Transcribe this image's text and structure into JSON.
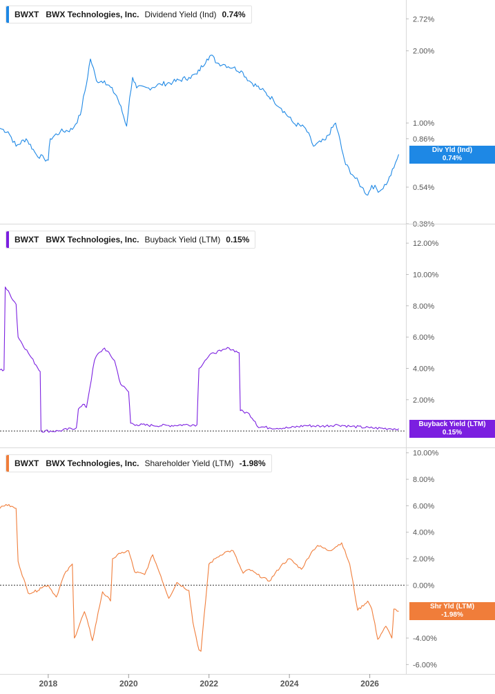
{
  "colors": {
    "dividend": "#1e88e5",
    "buyback": "#7b1fe0",
    "shareholder": "#f07d3a",
    "divider": "#d9d9d9",
    "axis_text": "#555555"
  },
  "x_axis": {
    "range": [
      2016.8,
      2026.9
    ],
    "ticks": [
      {
        "value": 2018,
        "label": "2018"
      },
      {
        "value": 2020,
        "label": "2020"
      },
      {
        "value": 2022,
        "label": "2022"
      },
      {
        "value": 2024,
        "label": "2024"
      },
      {
        "value": 2026,
        "label": "2026"
      }
    ]
  },
  "panels": [
    {
      "id": "dividend",
      "legend": {
        "ticker": "BWXT",
        "company": "BWX Technologies, Inc.",
        "metric": "Dividend Yield (Ind)",
        "value": "0.74%"
      },
      "badge": {
        "label": "Div Yld (Ind)",
        "value": "0.74%"
      },
      "badge_hidden_tick": "0.70%",
      "scale": "log",
      "ylim": [
        0.38,
        3.05
      ],
      "ticks": [
        {
          "value": 2.72,
          "label": "2.72%"
        },
        {
          "value": 2.0,
          "label": "2.00%"
        },
        {
          "value": 1.0,
          "label": "1.00%"
        },
        {
          "value": 0.86,
          "label": "0.86%"
        },
        {
          "value": 0.54,
          "label": "0.54%"
        },
        {
          "value": 0.38,
          "label": "0.38%"
        }
      ],
      "zero_line": false
    },
    {
      "id": "buyback",
      "legend": {
        "ticker": "BWXT",
        "company": "BWX Technologies, Inc.",
        "metric": "Buyback Yield (LTM)",
        "value": "0.15%"
      },
      "badge": {
        "label": "Buyback Yield (LTM)",
        "value": "0.15%"
      },
      "scale": "linear",
      "ylim": [
        -0.7,
        12.8
      ],
      "ticks": [
        {
          "value": 12,
          "label": "12.00%"
        },
        {
          "value": 10,
          "label": "10.00%"
        },
        {
          "value": 8,
          "label": "8.00%"
        },
        {
          "value": 6,
          "label": "6.00%"
        },
        {
          "value": 4,
          "label": "4.00%"
        },
        {
          "value": 2,
          "label": "2.00%"
        }
      ],
      "zero_line": true
    },
    {
      "id": "shareholder",
      "legend": {
        "ticker": "BWXT",
        "company": "BWX Technologies, Inc.",
        "metric": "Shareholder Yield (LTM)",
        "value": "-1.98%"
      },
      "badge": {
        "label": "Shr Yld (LTM)",
        "value": "-1.98%"
      },
      "scale": "linear",
      "ylim": [
        -6.4,
        10.3
      ],
      "ticks": [
        {
          "value": 10,
          "label": "10.00%"
        },
        {
          "value": 8,
          "label": "8.00%"
        },
        {
          "value": 6,
          "label": "6.00%"
        },
        {
          "value": 4,
          "label": "4.00%"
        },
        {
          "value": 2,
          "label": "2.00%"
        },
        {
          "value": 0,
          "label": "0.00%"
        },
        {
          "value": -4,
          "label": "-4.00%"
        },
        {
          "value": -6,
          "label": "-6.00%"
        }
      ],
      "zero_line": true
    }
  ],
  "chart_data": [
    {
      "type": "line",
      "series": [
        {
          "name": "Dividend Yield (Ind)"
        }
      ],
      "scale": "log",
      "x": [
        2016.8,
        2017.0,
        2017.2,
        2017.45,
        2017.7,
        2017.9,
        2018.0,
        2018.05,
        2018.3,
        2018.6,
        2018.8,
        2018.95,
        2019.05,
        2019.2,
        2019.4,
        2019.7,
        2019.95,
        2020.1,
        2020.2,
        2020.5,
        2020.8,
        2021.1,
        2021.5,
        2021.7,
        2021.95,
        2022.05,
        2022.2,
        2022.4,
        2022.6,
        2022.8,
        2023.0,
        2023.3,
        2023.6,
        2023.8,
        2024.1,
        2024.4,
        2024.6,
        2024.9,
        2025.15,
        2025.3,
        2025.4,
        2025.6,
        2025.8,
        2025.95,
        2026.05,
        2026.25,
        2026.45,
        2026.6,
        2026.72
      ],
      "values": [
        0.95,
        0.92,
        0.8,
        0.86,
        0.74,
        0.71,
        0.7,
        0.86,
        0.92,
        0.94,
        1.08,
        1.45,
        1.85,
        1.5,
        1.5,
        1.3,
        0.97,
        1.55,
        1.4,
        1.4,
        1.45,
        1.48,
        1.55,
        1.6,
        1.85,
        1.92,
        1.78,
        1.75,
        1.7,
        1.65,
        1.5,
        1.38,
        1.25,
        1.15,
        1.0,
        0.95,
        0.8,
        0.85,
        1.0,
        0.78,
        0.67,
        0.6,
        0.54,
        0.5,
        0.55,
        0.52,
        0.57,
        0.65,
        0.74
      ],
      "ylim": [
        0.38,
        3.05
      ],
      "last_value": "0.74%"
    },
    {
      "type": "line",
      "series": [
        {
          "name": "Buyback Yield (LTM)"
        }
      ],
      "x": [
        2016.8,
        2016.9,
        2016.93,
        2017.2,
        2017.25,
        2017.5,
        2017.7,
        2017.8,
        2017.82,
        2018.25,
        2018.7,
        2018.75,
        2018.9,
        2018.95,
        2019.15,
        2019.2,
        2019.4,
        2019.65,
        2019.8,
        2020.0,
        2020.05,
        2020.2,
        2020.6,
        2021.0,
        2021.4,
        2021.7,
        2021.75,
        2021.9,
        2022.1,
        2022.3,
        2022.5,
        2022.75,
        2022.78,
        2023.0,
        2023.15,
        2023.2,
        2023.5,
        2024.0,
        2024.4,
        2024.8,
        2025.2,
        2025.5,
        2026.0,
        2026.5,
        2026.72
      ],
      "values": [
        3.9,
        3.9,
        9.2,
        8.1,
        6.0,
        5.0,
        4.2,
        3.8,
        0.0,
        0.0,
        0.2,
        1.4,
        1.7,
        1.5,
        4.5,
        4.8,
        5.3,
        4.5,
        3.0,
        2.5,
        0.5,
        0.4,
        0.35,
        0.35,
        0.4,
        0.4,
        4.0,
        4.5,
        5.0,
        5.1,
        5.3,
        5.0,
        1.3,
        1.1,
        0.6,
        0.3,
        0.2,
        0.2,
        0.35,
        0.3,
        0.4,
        0.3,
        0.2,
        0.15,
        0.15
      ],
      "ylim": [
        -0.7,
        12.8
      ],
      "last_value": "0.15%"
    },
    {
      "type": "line",
      "series": [
        {
          "name": "Shareholder Yield (LTM)"
        }
      ],
      "x": [
        2016.8,
        2016.95,
        2017.2,
        2017.25,
        2017.5,
        2017.75,
        2017.8,
        2018.0,
        2018.2,
        2018.4,
        2018.6,
        2018.65,
        2018.9,
        2019.0,
        2019.1,
        2019.35,
        2019.55,
        2019.6,
        2019.8,
        2020.0,
        2020.15,
        2020.4,
        2020.6,
        2020.8,
        2021.0,
        2021.2,
        2021.5,
        2021.6,
        2021.75,
        2021.8,
        2022.0,
        2022.2,
        2022.4,
        2022.6,
        2022.8,
        2022.85,
        2023.0,
        2023.2,
        2023.5,
        2023.8,
        2024.0,
        2024.3,
        2024.55,
        2024.7,
        2025.0,
        2025.3,
        2025.5,
        2025.7,
        2025.95,
        2026.05,
        2026.2,
        2026.4,
        2026.55,
        2026.6,
        2026.72
      ],
      "values": [
        5.8,
        6.1,
        5.8,
        1.8,
        -0.6,
        -0.4,
        -0.2,
        0.0,
        -0.9,
        0.8,
        1.6,
        -4.0,
        -2.0,
        -3.0,
        -4.2,
        -0.5,
        -1.2,
        2.0,
        2.4,
        2.6,
        1.0,
        0.8,
        2.3,
        0.7,
        -1.0,
        0.2,
        -0.4,
        -2.8,
        -4.9,
        -5.0,
        1.6,
        2.1,
        2.5,
        2.6,
        1.2,
        0.9,
        1.2,
        0.8,
        0.3,
        1.5,
        2.0,
        1.2,
        2.5,
        3.0,
        2.6,
        3.2,
        1.6,
        -1.9,
        -1.2,
        -1.8,
        -4.1,
        -3.1,
        -4.0,
        -1.8,
        -1.98
      ],
      "ylim": [
        -6.4,
        10.3
      ],
      "last_value": "-1.98%"
    }
  ]
}
